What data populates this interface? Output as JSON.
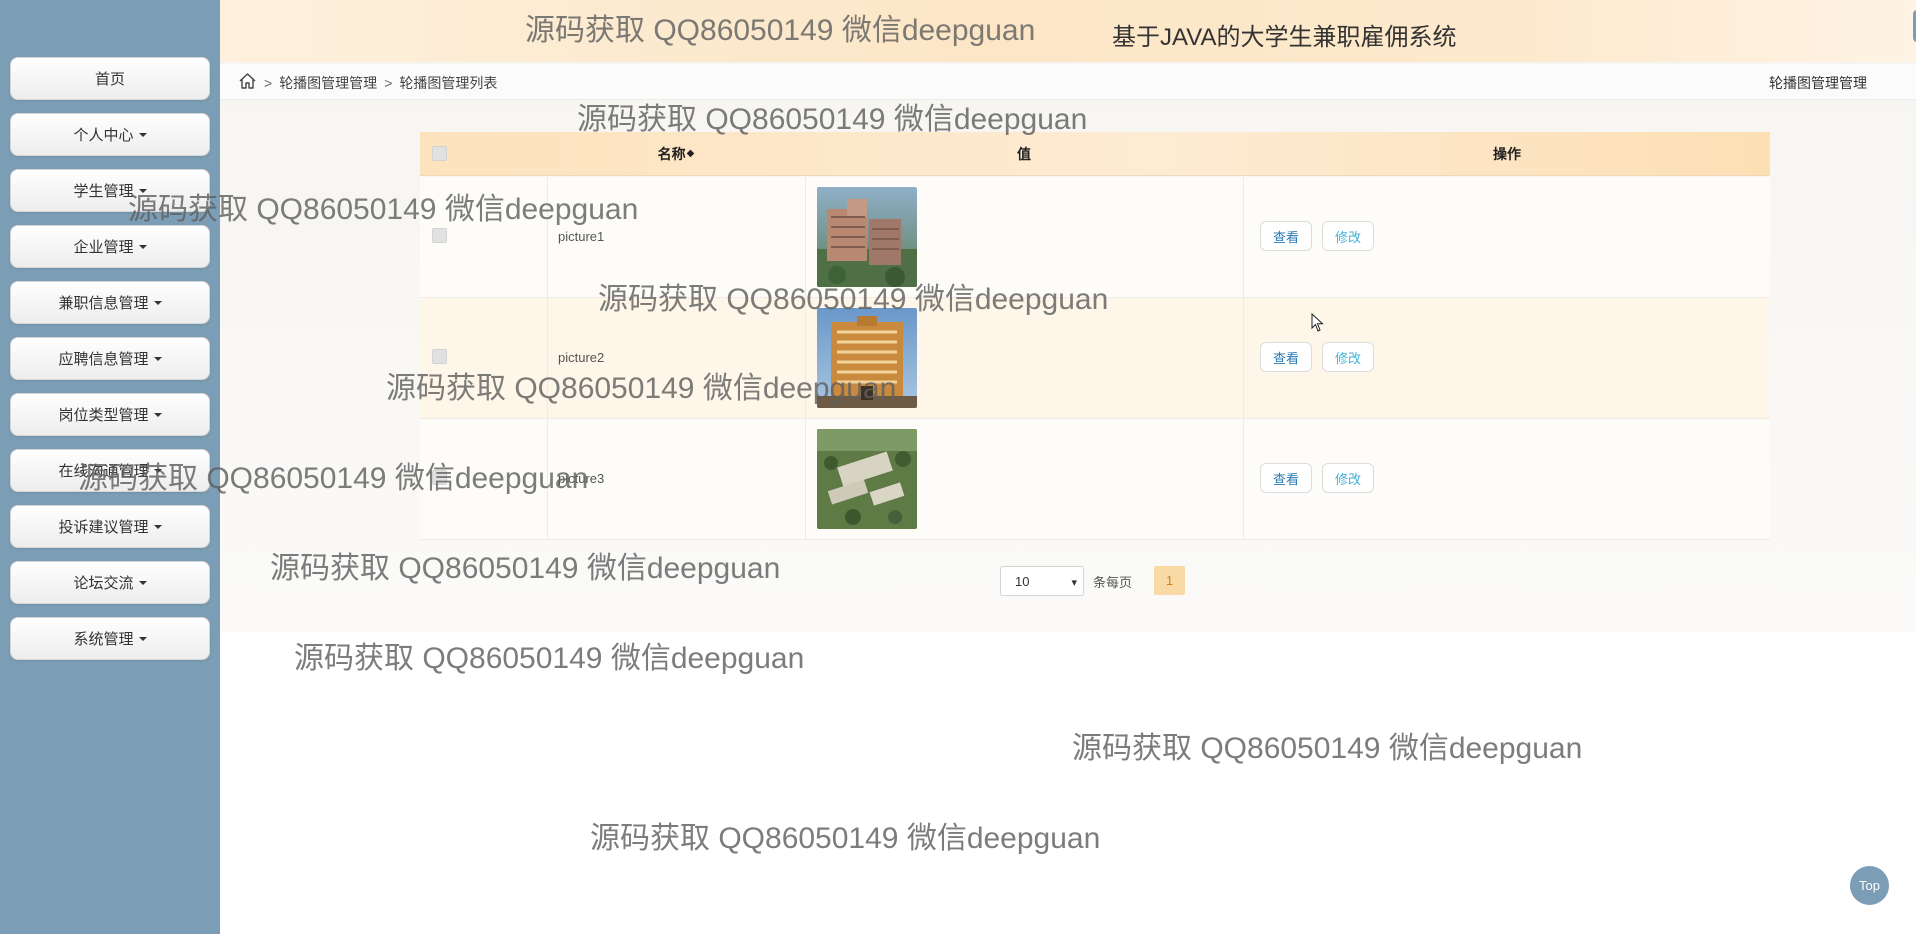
{
  "app": {
    "title": "基于JAVA的大学生兼职雇佣系统"
  },
  "sidebar": {
    "items": [
      {
        "label": "首页",
        "has_caret": false
      },
      {
        "label": "个人中心",
        "has_caret": true
      },
      {
        "label": "学生管理",
        "has_caret": true
      },
      {
        "label": "企业管理",
        "has_caret": true
      },
      {
        "label": "兼职信息管理",
        "has_caret": true
      },
      {
        "label": "应聘信息管理",
        "has_caret": true
      },
      {
        "label": "岗位类型管理",
        "has_caret": true
      },
      {
        "label": "在线沟通管理",
        "has_caret": true
      },
      {
        "label": "投诉建议管理",
        "has_caret": true
      },
      {
        "label": "论坛交流",
        "has_caret": true
      },
      {
        "label": "系统管理",
        "has_caret": true
      }
    ]
  },
  "header": {
    "fullscreen_icon": "fullscreen-icon",
    "user_icon": "user-icon"
  },
  "breadcrumb": {
    "home_icon": "home-icon",
    "separator": ">",
    "items": [
      "轮播图管理管理",
      "轮播图管理列表"
    ],
    "right_label": "轮播图管理管理"
  },
  "table": {
    "headers": {
      "name": "名称",
      "value": "值",
      "actions": "操作"
    },
    "rows": [
      {
        "name": "picture1",
        "image": "campus aerial photo",
        "view": "查看",
        "edit": "修改"
      },
      {
        "name": "picture2",
        "image": "building photo",
        "view": "查看",
        "edit": "修改"
      },
      {
        "name": "picture3",
        "image": "campus aerial photo",
        "view": "查看",
        "edit": "修改"
      }
    ]
  },
  "pagination": {
    "page_size": "10",
    "per_page_label": "条每页",
    "current_page": "1"
  },
  "top_button": {
    "label": "Top"
  },
  "watermark": {
    "text": "源码获取 QQ86050149 微信deepguan"
  },
  "colors": {
    "sidebar": "#7b9db5",
    "header_accent": "#fce6c6",
    "active_page": "#f9d9a4"
  }
}
